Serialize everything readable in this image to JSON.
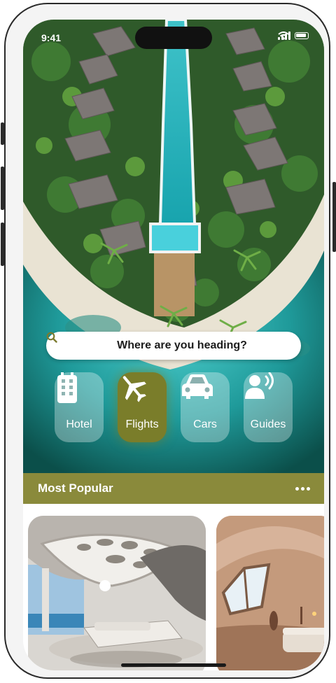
{
  "status_bar": {
    "time": "9:41"
  },
  "search": {
    "placeholder_text": "Where are you heading?"
  },
  "categories": [
    {
      "label": "Hotel",
      "icon": "hotel-building-icon",
      "active": false
    },
    {
      "label": "Flights",
      "icon": "airplane-icon",
      "active": true
    },
    {
      "label": "Cars",
      "icon": "car-icon",
      "active": false
    },
    {
      "label": "Guides",
      "icon": "tour-guide-icon",
      "active": false
    }
  ],
  "most_popular": {
    "title": "Most Popular",
    "more_icon": "more-dots-icon"
  },
  "colors": {
    "accent": "#8a8a3b",
    "active_tile": "#7a7d2a",
    "sea": "#0c5a55"
  }
}
